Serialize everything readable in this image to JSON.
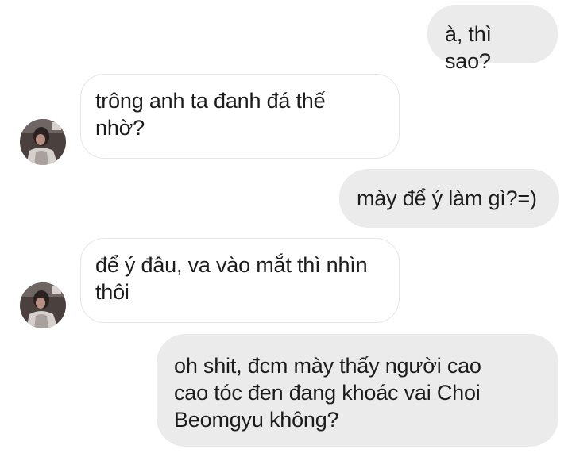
{
  "conversation": {
    "messages": [
      {
        "sender": "me",
        "text": "à, thì sao?"
      },
      {
        "sender": "other",
        "text": "trông anh ta đanh đá thế\nnhờ?"
      },
      {
        "sender": "me",
        "text": "mày để ý làm gì?=)"
      },
      {
        "sender": "other",
        "text": "để ý đâu, va vào mắt thì nhìn\nthôi"
      },
      {
        "sender": "me",
        "text": "oh shit, đcm mày thấy người cao\ncao tóc đen đang khoác vai Choi\nBeomgyu không?"
      }
    ]
  },
  "colors": {
    "outgoing_bubble": "#ebebeb",
    "incoming_bubble": "#ffffff",
    "incoming_border": "#e6e6e6",
    "text": "#1c1c1c"
  },
  "icons": {
    "contact_avatar": "avatar-icon"
  }
}
